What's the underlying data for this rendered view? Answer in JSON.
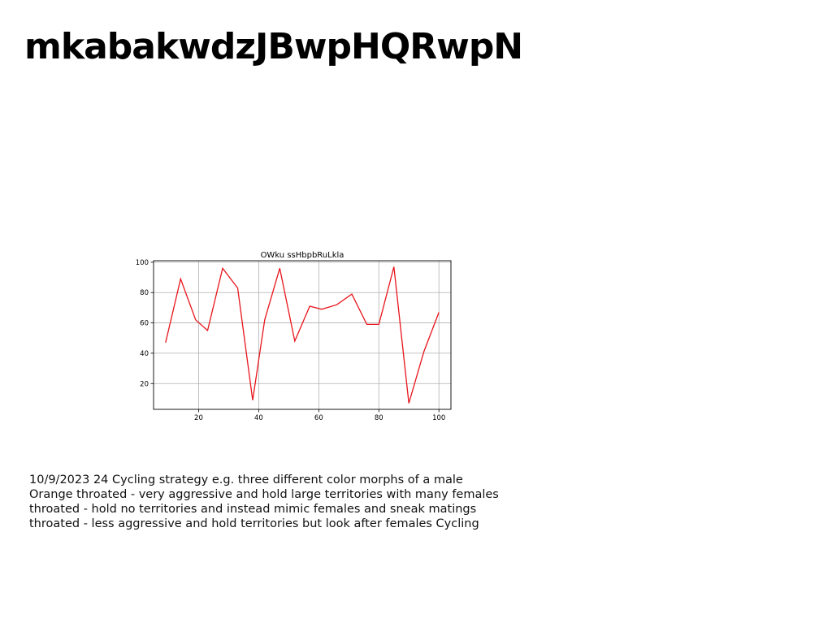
{
  "slide": {
    "title": "mkabakwdzJBwpHQRwpN",
    "body_lines": [
      "10/9/2023 24 Cycling strategy e.g. three different color morphs of a male",
      "Orange throated - very aggressive and hold large territories with many females",
      "throated - hold no territories and instead mimic females and sneak matings",
      "throated - less aggressive and hold territories but look after females Cycling"
    ]
  },
  "chart_data": {
    "type": "line",
    "title": "OWku ssHbpbRuLkla",
    "xlabel": "",
    "ylabel": "",
    "xlim": [
      5,
      104
    ],
    "ylim": [
      3,
      101
    ],
    "xticks": [
      20,
      40,
      60,
      80,
      100
    ],
    "yticks": [
      20,
      40,
      60,
      80,
      100
    ],
    "grid": true,
    "series": [
      {
        "color": "#e8141b",
        "x": [
          9,
          14,
          19,
          23,
          28,
          33,
          38,
          42,
          47,
          52,
          57,
          61,
          66,
          71,
          76,
          80,
          85,
          90,
          95,
          100
        ],
        "y": [
          47,
          89,
          62,
          55,
          96,
          83,
          9,
          62,
          96,
          48,
          71,
          69,
          72,
          79,
          59,
          59,
          97,
          7,
          41,
          67
        ]
      }
    ]
  }
}
